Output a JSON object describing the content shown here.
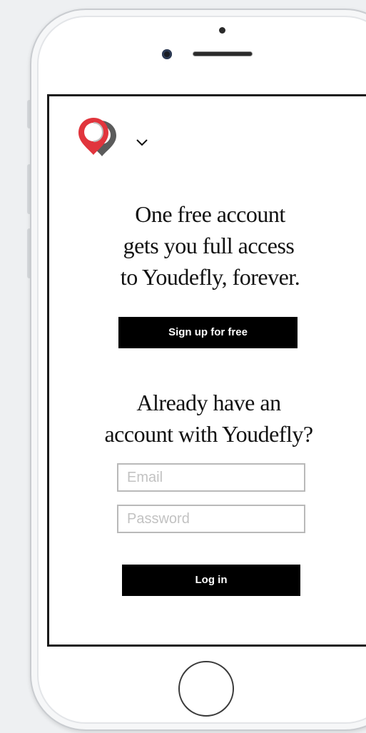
{
  "brand": {
    "logo_icon": "youdefly-pin-logo-icon",
    "menu_icon": "chevron-down-icon",
    "colors": {
      "logo_red": "#e1353d",
      "logo_gray": "#5a5a5a",
      "button_bg": "#000000",
      "button_text": "#ffffff"
    }
  },
  "signup": {
    "headline_lines": [
      "One free account",
      "gets you full access",
      "to Youdefly, forever."
    ],
    "button_label": "Sign up for free"
  },
  "login": {
    "headline_lines": [
      "Already have an",
      "account with Youdefly?"
    ],
    "email_placeholder": "Email",
    "password_placeholder": "Password",
    "button_label": "Log in"
  },
  "device": {
    "home_button_icon": "home-button-icon"
  }
}
